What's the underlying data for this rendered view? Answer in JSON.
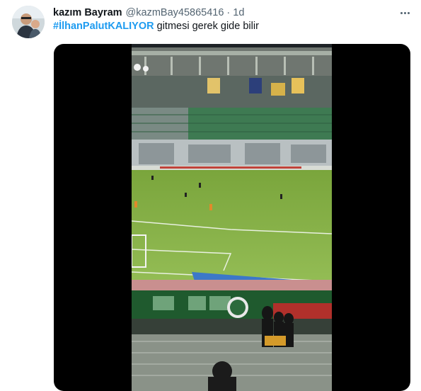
{
  "tweet": {
    "author_name": "kazım Bayram",
    "author_handle": "@kazmBay45865416",
    "separator": "·",
    "timestamp": "1d",
    "hashtag": "#İlhanPalutKALIYOR",
    "body_text": " gitmesi gerek gide bilir",
    "more_icon": "more-horizontal-icon",
    "media_description_icon": "video-thumbnail"
  },
  "colors": {
    "link": "#1d9bf0",
    "secondary_text": "#536471",
    "primary_text": "#0f1419",
    "media_background": "#000000",
    "pitch_green": "#8fb54a"
  }
}
